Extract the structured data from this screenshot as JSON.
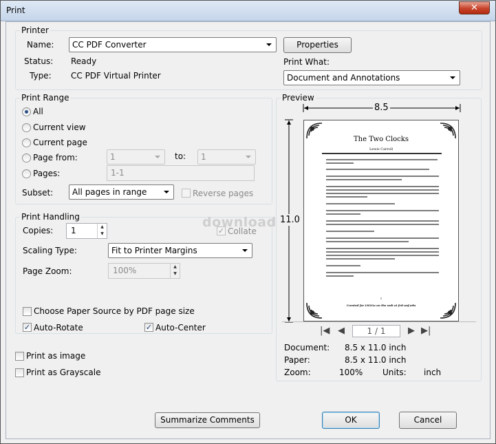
{
  "window": {
    "title": "Print",
    "close_glyph": "✕"
  },
  "printer": {
    "legend": "Printer",
    "name_label": "Name:",
    "name_value": "CC PDF Converter",
    "status_label": "Status:",
    "status_value": "Ready",
    "type_label": "Type:",
    "type_value": "CC PDF Virtual Printer",
    "properties_button": "Properties",
    "print_what_label": "Print What:",
    "print_what_value": "Document and Annotations"
  },
  "print_range": {
    "legend": "Print Range",
    "all": "All",
    "current_view": "Current view",
    "current_page": "Current page",
    "page_from": "Page from:",
    "page_from_value": "1",
    "to_label": "to:",
    "to_value": "1",
    "pages": "Pages:",
    "pages_value": "1-1",
    "subset_label": "Subset:",
    "subset_value": "All pages in range",
    "reverse_pages": "Reverse pages"
  },
  "print_handling": {
    "legend": "Print Handling",
    "copies_label": "Copies:",
    "copies_value": "1",
    "collate": "Collate",
    "scaling_label": "Scaling Type:",
    "scaling_value": "Fit to Printer Margins",
    "zoom_label": "Page Zoom:",
    "zoom_value": "100%",
    "paper_source": "Choose Paper Source by PDF page size",
    "auto_rotate": "Auto-Rotate",
    "auto_center": "Auto-Center"
  },
  "options": {
    "print_as_image": "Print as image",
    "print_as_grayscale": "Print as Grayscale"
  },
  "preview": {
    "legend": "Preview",
    "width_label": "8.5",
    "height_label": "11.0",
    "doc_title": "The Two Clocks",
    "doc_author": "Lewis Carroll",
    "doc_page_num": "1",
    "doc_footer": "Created for Lit2Go on the web at fcit.usf.edu",
    "page_indicator": "1 / 1",
    "document_label": "Document:",
    "document_value": "8.5 x 11.0 inch",
    "paper_label": "Paper:",
    "paper_value": "8.5 x 11.0 inch",
    "zoom_label": "Zoom:",
    "zoom_value": "100%",
    "units_label": "Units:",
    "units_value": "inch"
  },
  "buttons": {
    "summarize": "Summarize Comments",
    "ok": "OK",
    "cancel": "Cancel"
  },
  "watermark": "download"
}
